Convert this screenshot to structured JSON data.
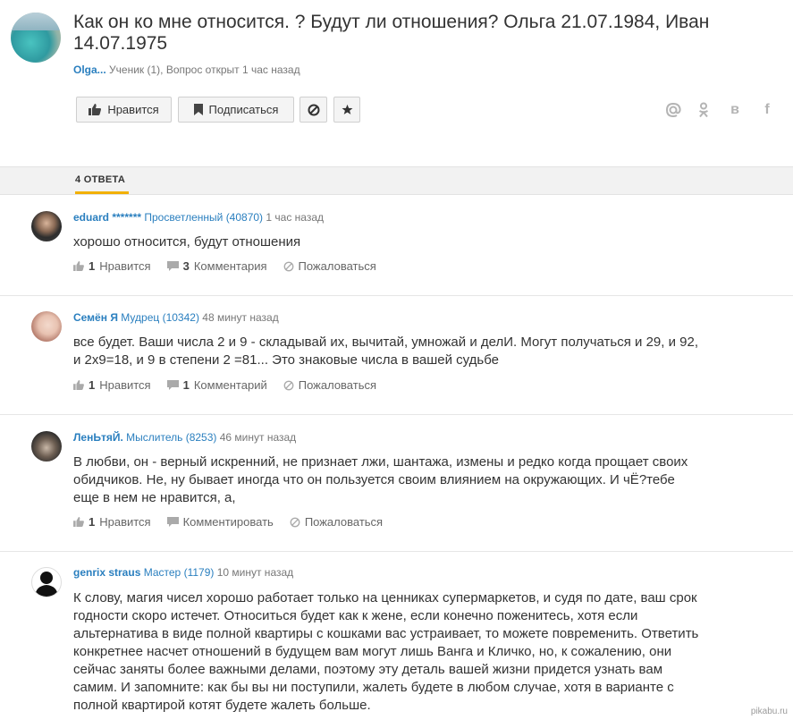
{
  "question": {
    "title": "Как он ко мне относится. ? Будут ли отношения? Ольга 21.07.1984, Иван 14.07.1975",
    "user": "Olga...",
    "meta": "Ученик (1), Вопрос открыт 1 час назад"
  },
  "toolbar": {
    "like_label": "Нравится",
    "subscribe_label": "Подписаться"
  },
  "social": {
    "vk": "в",
    "fb": "f"
  },
  "tabs": {
    "answers_label": "4 ОТВЕТА"
  },
  "answers": [
    {
      "name": "eduard *******",
      "rank": "Просветленный (40870)",
      "time": "1 час назад",
      "text": "хорошо относится, будут отношения",
      "likes": "1",
      "like_label": "Нравится",
      "comments": "3",
      "comments_label": "Комментария",
      "report_label": "Пожаловаться"
    },
    {
      "name": "Семён Я",
      "rank": "Мудрец (10342)",
      "time": "48 минут назад",
      "text": "все будет. Ваши числа 2 и 9 - складывай их, вычитай, умножай и делИ. Могут получаться и 29, и 92, и 2х9=18, и 9 в степени 2 =81... Это знаковые числа в вашей судьбе",
      "likes": "1",
      "like_label": "Нравится",
      "comments": "1",
      "comments_label": "Комментарий",
      "report_label": "Пожаловаться"
    },
    {
      "name": "ЛенЬтяЙ.",
      "rank": "Мыслитель (8253)",
      "time": "46 минут назад",
      "text": "В любви, он - верный искренний, не признает лжи, шантажа, измены и редко когда прощает своих обидчиков. Не, ну бывает иногда что он пользуется своим влиянием на окружающих. И чЁ?тебе еще в нем не нравится, а,",
      "likes": "1",
      "like_label": "Нравится",
      "comments_label": "Комментировать",
      "report_label": "Пожаловаться"
    },
    {
      "name": "genrix straus",
      "rank": "Мастер (1179)",
      "time": "10 минут назад",
      "text": "К слову, магия чисел хорошо работает только на ценниках супермаркетов, и судя по дате, ваш срок годности скоро истечет. Относиться будет как к жене, если конечно поженитесь, хотя если альтернатива в виде полной квартиры с кошками вас устраивает, то можете повременить. Ответить конкретнее насчет отношений в будущем вам могут лишь Ванга и Кличко, но, к сожалению, они сейчас заняты более важными делами, поэтому эту деталь вашей жизни придется узнать вам самим. И запомните: как бы вы ни поступили, жалеть будете в любом случае, хотя в варианте с полной квартирой котят будете жалеть больше.",
      "avatar_text": "No Photo"
    }
  ],
  "watermark": "pikabu.ru",
  "colors": {
    "link": "#2a7fbf",
    "accent": "#f2b000"
  }
}
